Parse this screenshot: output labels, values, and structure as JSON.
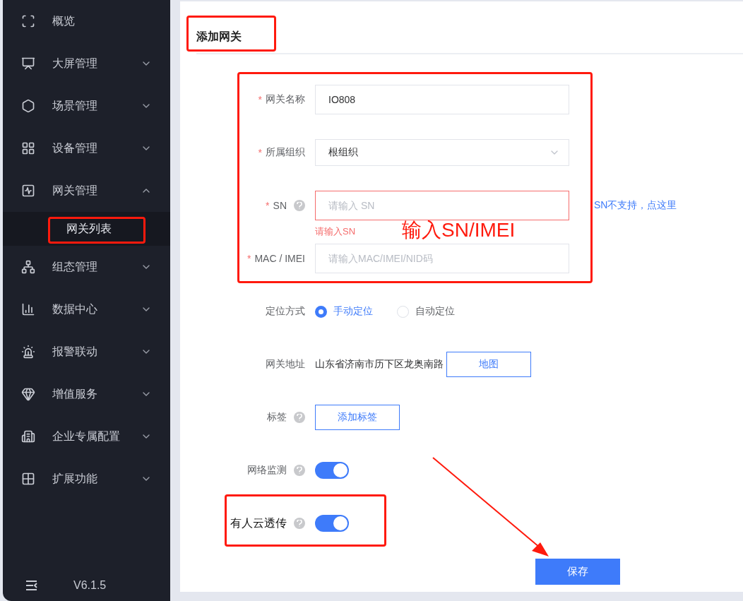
{
  "sidebar": {
    "items": [
      {
        "label": "概览",
        "kind": "link"
      },
      {
        "label": "大屏管理",
        "kind": "group",
        "expanded": false
      },
      {
        "label": "场景管理",
        "kind": "group",
        "expanded": false
      },
      {
        "label": "设备管理",
        "kind": "group",
        "expanded": false
      },
      {
        "label": "网关管理",
        "kind": "group",
        "expanded": true,
        "children": [
          {
            "label": "网关列表",
            "selected": true
          }
        ]
      },
      {
        "label": "组态管理",
        "kind": "group",
        "expanded": false
      },
      {
        "label": "数据中心",
        "kind": "group",
        "expanded": false
      },
      {
        "label": "报警联动",
        "kind": "group",
        "expanded": false
      },
      {
        "label": "增值服务",
        "kind": "group",
        "expanded": false
      },
      {
        "label": "企业专属配置",
        "kind": "group",
        "expanded": false
      },
      {
        "label": "扩展功能",
        "kind": "group",
        "expanded": false
      }
    ],
    "version": "V6.1.5"
  },
  "page": {
    "title": "添加网关"
  },
  "form": {
    "fields": [
      {
        "kind": "input",
        "required_mark": "*",
        "label": "网关名称",
        "value": "IO808"
      },
      {
        "kind": "select",
        "required_mark": "*",
        "label": "所属组织",
        "value": "根组织"
      },
      {
        "kind": "input",
        "required_mark": "*",
        "label": "SN",
        "help": true,
        "placeholder": "请输入 SN",
        "error": "请输入SN",
        "side_link": "SN不支持，点这里"
      },
      {
        "kind": "input",
        "required_mark": "*",
        "label": "MAC / IMEI",
        "placeholder": "请输入MAC/IMEI/NID码"
      },
      {
        "kind": "radio",
        "label": "定位方式",
        "options": [
          {
            "label": "手动定位",
            "selected": true
          },
          {
            "label": "自动定位",
            "selected": false
          }
        ]
      },
      {
        "kind": "address",
        "label": "网关地址",
        "value": "山东省济南市历下区龙奥南路",
        "button": "地图"
      },
      {
        "kind": "button",
        "label": "标签",
        "help": true,
        "button": "添加标签"
      },
      {
        "kind": "switch",
        "label": "网络监测",
        "help": true,
        "on": true
      },
      {
        "kind": "switch",
        "label": "有人云透传",
        "help": true,
        "on": true,
        "emphasized": true
      }
    ],
    "save_button": "保存"
  },
  "annotation": {
    "note": "输入SN/IMEI"
  }
}
